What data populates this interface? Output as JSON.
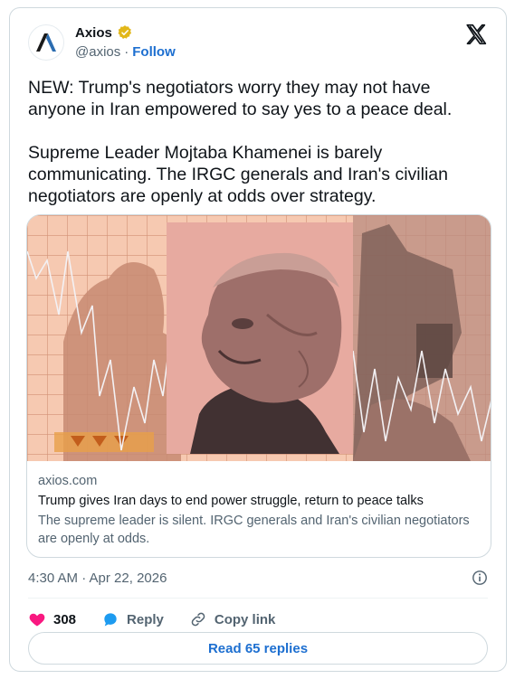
{
  "author": {
    "display_name": "Axios",
    "handle": "@axios",
    "separator": "·",
    "follow_label": "Follow"
  },
  "tweet": {
    "text": "NEW: Trump's negotiators worry they may not have anyone in Iran empowered to say yes to a peace deal.\n\nSupreme Leader Mojtaba Khamenei is barely communicating. The IRGC generals and Iran's civilian negotiators are openly at odds over strategy.",
    "timestamp": "4:30 AM · Apr 22, 2026"
  },
  "link_card": {
    "domain": "axios.com",
    "title": "Trump gives Iran days to end power struggle, return to peace talks",
    "description": "The supreme leader is silent. IRGC generals and Iran's civilian negotiators are openly at odds."
  },
  "actions": {
    "likes_count": "308",
    "reply_label": "Reply",
    "copy_link_label": "Copy link"
  },
  "read_replies_label": "Read 65 replies",
  "colors": {
    "accent": "#1d6fd0",
    "like": "#f91880",
    "verified": "#e2b719",
    "media_tint": "#f4bfa4"
  },
  "icons": [
    "axios-logo-icon",
    "verified-badge-icon",
    "x-logo-icon",
    "info-icon",
    "heart-icon",
    "reply-bubble-icon",
    "link-icon"
  ]
}
